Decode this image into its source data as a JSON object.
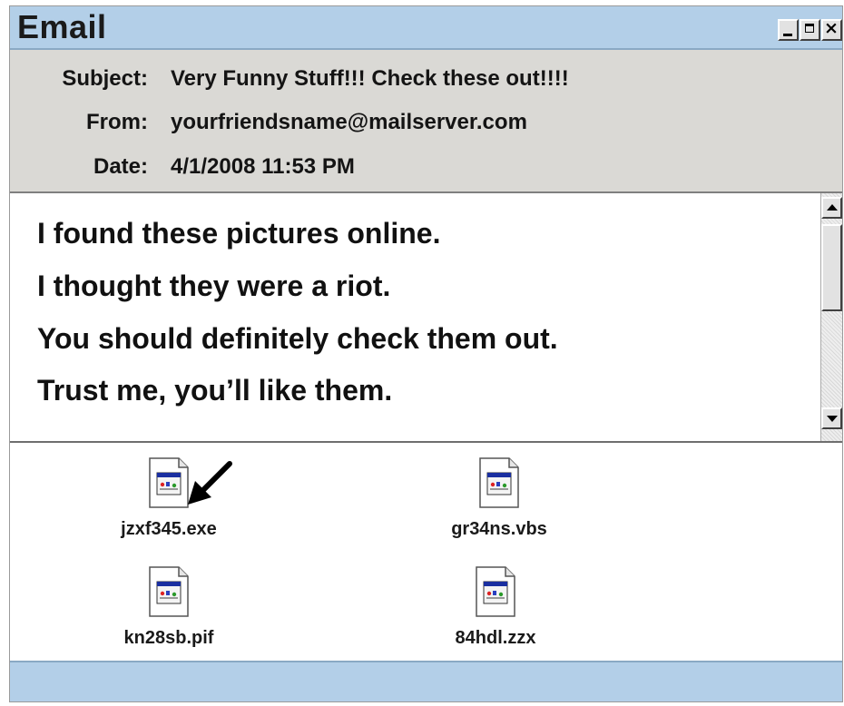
{
  "window": {
    "title": "Email"
  },
  "header": {
    "subject_label": "Subject:",
    "subject_value": "Very Funny Stuff!!! Check these out!!!!",
    "from_label": "From:",
    "from_value": "yourfriendsname@mailserver.com",
    "date_label": "Date:",
    "date_value": "4/1/2008 11:53 PM"
  },
  "body": {
    "lines": [
      "I found these pictures online.",
      "I thought they were a riot.",
      "You should definitely check them out.",
      "Trust me, you’ll like them."
    ]
  },
  "attachments": [
    {
      "name": "jzxf345.exe",
      "icon": "program-file-icon"
    },
    {
      "name": "gr34ns.vbs",
      "icon": "program-file-icon"
    },
    {
      "name": "kn28sb.pif",
      "icon": "program-file-icon"
    },
    {
      "name": "84hdl.zzx",
      "icon": "program-file-icon"
    }
  ],
  "colors": {
    "titlebar": "#b3cfe8",
    "header_bg": "#dad9d5",
    "statusbar": "#b3cfe8"
  }
}
